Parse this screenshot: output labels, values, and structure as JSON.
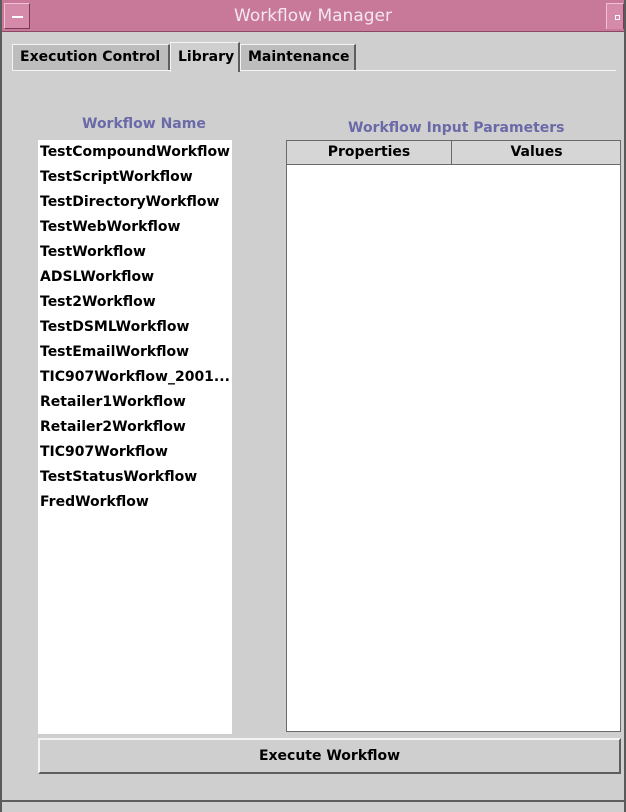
{
  "window": {
    "title": "Workflow Manager"
  },
  "tabs": [
    {
      "label": "Execution Control",
      "active": false
    },
    {
      "label": "Library",
      "active": true
    },
    {
      "label": "Maintenance",
      "active": false
    }
  ],
  "library": {
    "workflow_name_label": "Workflow Name",
    "input_params_label": "Workflow Input Parameters",
    "workflows": [
      "TestCompoundWorkflow",
      "TestScriptWorkflow",
      "TestDirectoryWorkflow",
      "TestWebWorkflow",
      "TestWorkflow",
      "ADSLWorkflow",
      "Test2Workflow",
      "TestDSMLWorkflow",
      "TestEmailWorkflow",
      "TIC907Workflow_2001...",
      "Retailer1Workflow",
      "Retailer2Workflow",
      "TIC907Workflow",
      "TestStatusWorkflow",
      "FredWorkflow"
    ],
    "params_columns": [
      "Properties",
      "Values"
    ],
    "execute_label": "Execute Workflow"
  },
  "colors": {
    "titlebar": "#c8799a",
    "section_label": "#6b6aa8",
    "panel": "#cfcfcf"
  }
}
